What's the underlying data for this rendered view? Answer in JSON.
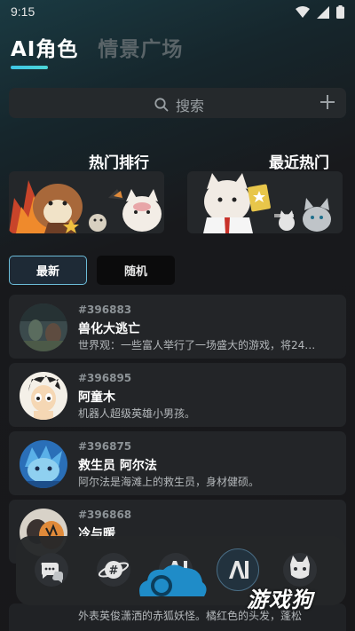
{
  "status": {
    "time": "9:15"
  },
  "tabs": [
    {
      "label": "AI角色",
      "active": true
    },
    {
      "label": "情景广场",
      "active": false
    }
  ],
  "search": {
    "placeholder": "搜索"
  },
  "banners": [
    {
      "title": "热门排行"
    },
    {
      "title": "最近热门"
    }
  ],
  "filters": [
    {
      "label": "最新",
      "active": true
    },
    {
      "label": "随机",
      "active": false
    }
  ],
  "characters": [
    {
      "id": "#396883",
      "name": "兽化大逃亡",
      "desc": "世界观：一些富人举行了一场盛大的游戏，将24…"
    },
    {
      "id": "#396895",
      "name": "阿童木",
      "desc": "机器人超级英雄小男孩。"
    },
    {
      "id": "#396875",
      "name": "救生员 阿尔法",
      "desc": "阿尔法是海滩上的救生员，身材健硕。"
    },
    {
      "id": "#396868",
      "name": "冷与暖",
      "desc": ""
    }
  ],
  "peek_desc": "外表英俊潇洒的赤狐妖怪。橘红色的头发，蓬松",
  "watermark": "游戏狗",
  "colors": {
    "accent": "#3ec5e6",
    "card": "#232528",
    "nav": "#242629"
  }
}
